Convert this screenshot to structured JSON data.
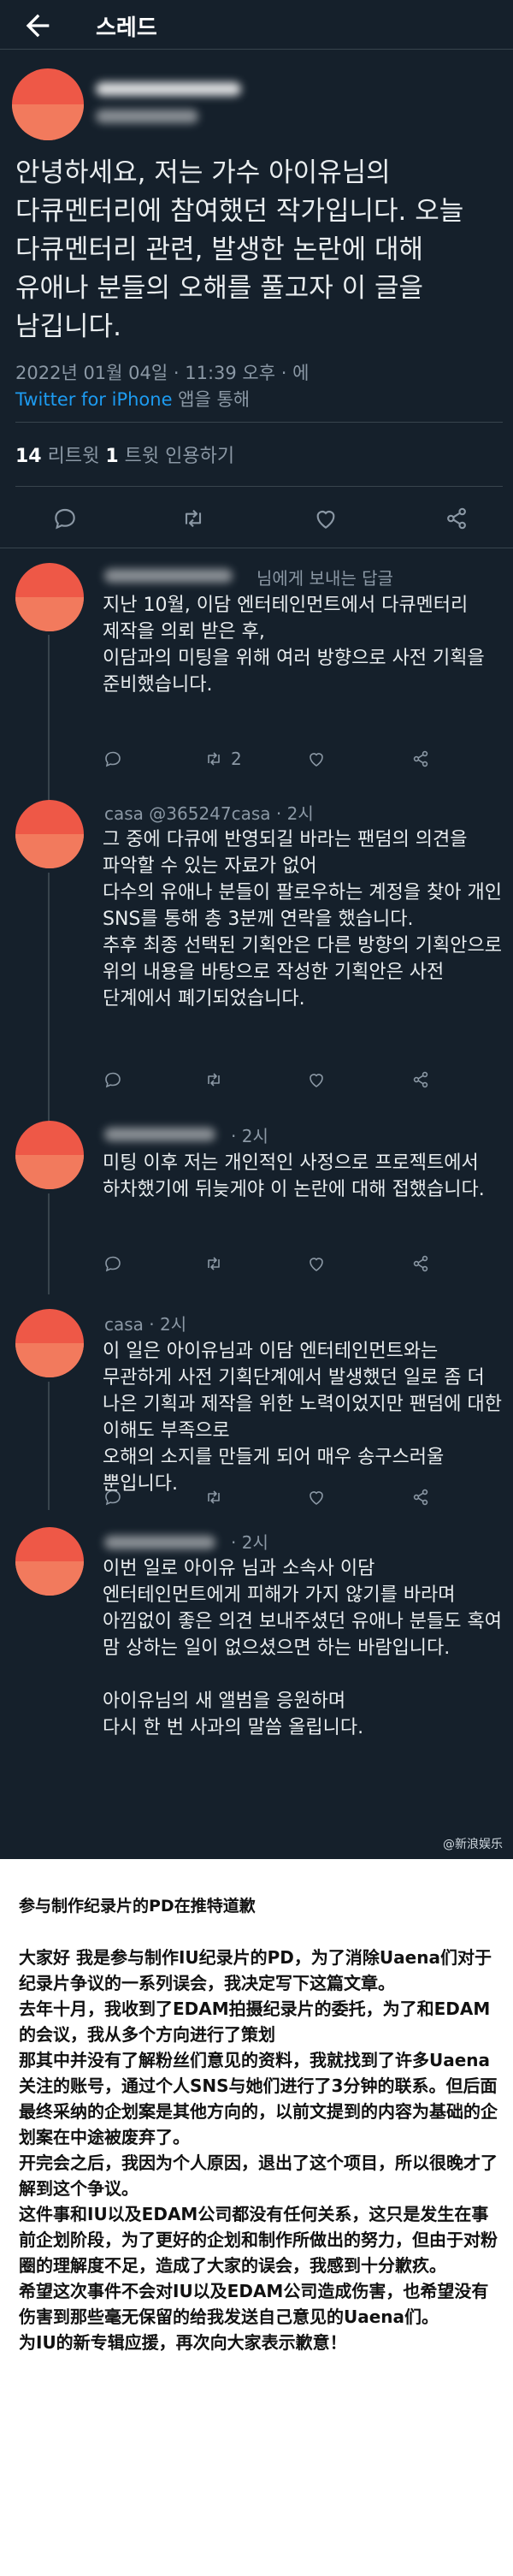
{
  "header": {
    "title": "스레드"
  },
  "tweet": {
    "text": "안녕하세요, 저는 가수 아이유님의 다큐멘터리에 참여했던 작가입니다. 오늘 다큐멘터리 관련, 발생한 논란에 대해 유애나 분들의 오해를 풀고자 이 글을 남깁니다.",
    "timestamp": "2022년 01월 04일 · 11:39 오후 · 에",
    "source_prefix": "",
    "source_app": "Twitter for iPhone",
    "source_suffix": " 앱을 통해",
    "retweets_count": "14",
    "retweets_label": " 리트윗  ",
    "quotes_count": "1",
    "quotes_label": " 트윗 인용하기"
  },
  "icons": {
    "back": "arrow-left-icon",
    "reply": "reply-icon",
    "retweet": "retweet-icon",
    "like": "heart-icon",
    "share": "share-icon"
  },
  "replies": [
    {
      "head": "님에게 보내는 답글",
      "text": "지난 10월, 이담 엔터테인먼트에서 다큐멘터리 제작을 의뢰 받은 후,\n이담과의 미팅을 위해 여러 방향으로 사전 기획을 준비했습니다.",
      "retweets": "2"
    },
    {
      "head": "casa @365247casa · 2시",
      "text": "그 중에 다큐에 반영되길 바라는 팬덤의 의견을 파악할 수 있는 자료가 없어\n다수의 유애나 분들이 팔로우하는 계정을 찾아 개인 SNS를 통해 총 3분께 연락을 했습니다.\n추후 최종 선택된 기획안은 다른 방향의 기획안으로\n위의 내용을 바탕으로 작성한 기획안은 사전 단계에서 폐기되었습니다.",
      "retweets": ""
    },
    {
      "head": "· 2시",
      "text": "미팅 이후 저는 개인적인 사정으로 프로젝트에서 하차했기에 뒤늦게야 이 논란에 대해 접했습니다.",
      "retweets": ""
    },
    {
      "head": "casa · 2시",
      "text": "이 일은 아이유님과 이담 엔터테인먼트와는 무관하게 사전 기획단계에서 발생했던 일로 좀 더 나은 기획과 제작을 위한 노력이었지만 팬덤에 대한 이해도 부족으로\n오해의 소지를 만들게 되어 매우 송구스러울 뿐입니다.",
      "retweets": ""
    },
    {
      "head": "· 2시",
      "text": "이번 일로 아이유 님과 소속사 이담 엔터테인먼트에게 피해가 가지 않기를 바라며 아낌없이 좋은 의견 보내주셨던 유애나 분들도 혹여 맘 상하는 일이 없으셨으면 하는 바람입니다.\n\n아이유님의 새 앨범을 응원하며\n다시 한 번 사과의 말씀 올립니다.",
      "retweets": ""
    }
  ],
  "watermark": "@新浪娱乐",
  "caption": {
    "title": "参与制作纪录片的PD在推特道歉",
    "paragraphs": [
      "大家好 我是参与制作IU纪录片的PD，为了消除Uaena们对于纪录片争议的一系列误会，我决定写下这篇文章。",
      "去年十月，我收到了EDAM拍摄纪录片的委托，为了和EDAM的会议，我从多个方向进行了策划",
      "那其中并没有了解粉丝们意见的资料，我就找到了许多Uaena关注的账号，通过个人SNS与她们进行了3分钟的联系。但后面最终采纳的企划案是其他方向的，以前文提到的内容为基础的企划案在中途被废弃了。",
      "开完会之后，我因为个人原因，退出了这个项目，所以很晚才了解到这个争议。",
      "这件事和IU以及EDAM公司都没有任何关系，这只是发生在事前企划阶段，为了更好的企划和制作所做出的努力，但由于对粉圈的理解度不足，造成了大家的误会，我感到十分歉疚。",
      "希望这次事件不会对IU以及EDAM公司造成伤害，也希望没有伤害到那些毫无保留的给我发送自己意见的Uaena们。",
      "为IU的新专辑应援，再次向大家表示歉意！"
    ]
  }
}
